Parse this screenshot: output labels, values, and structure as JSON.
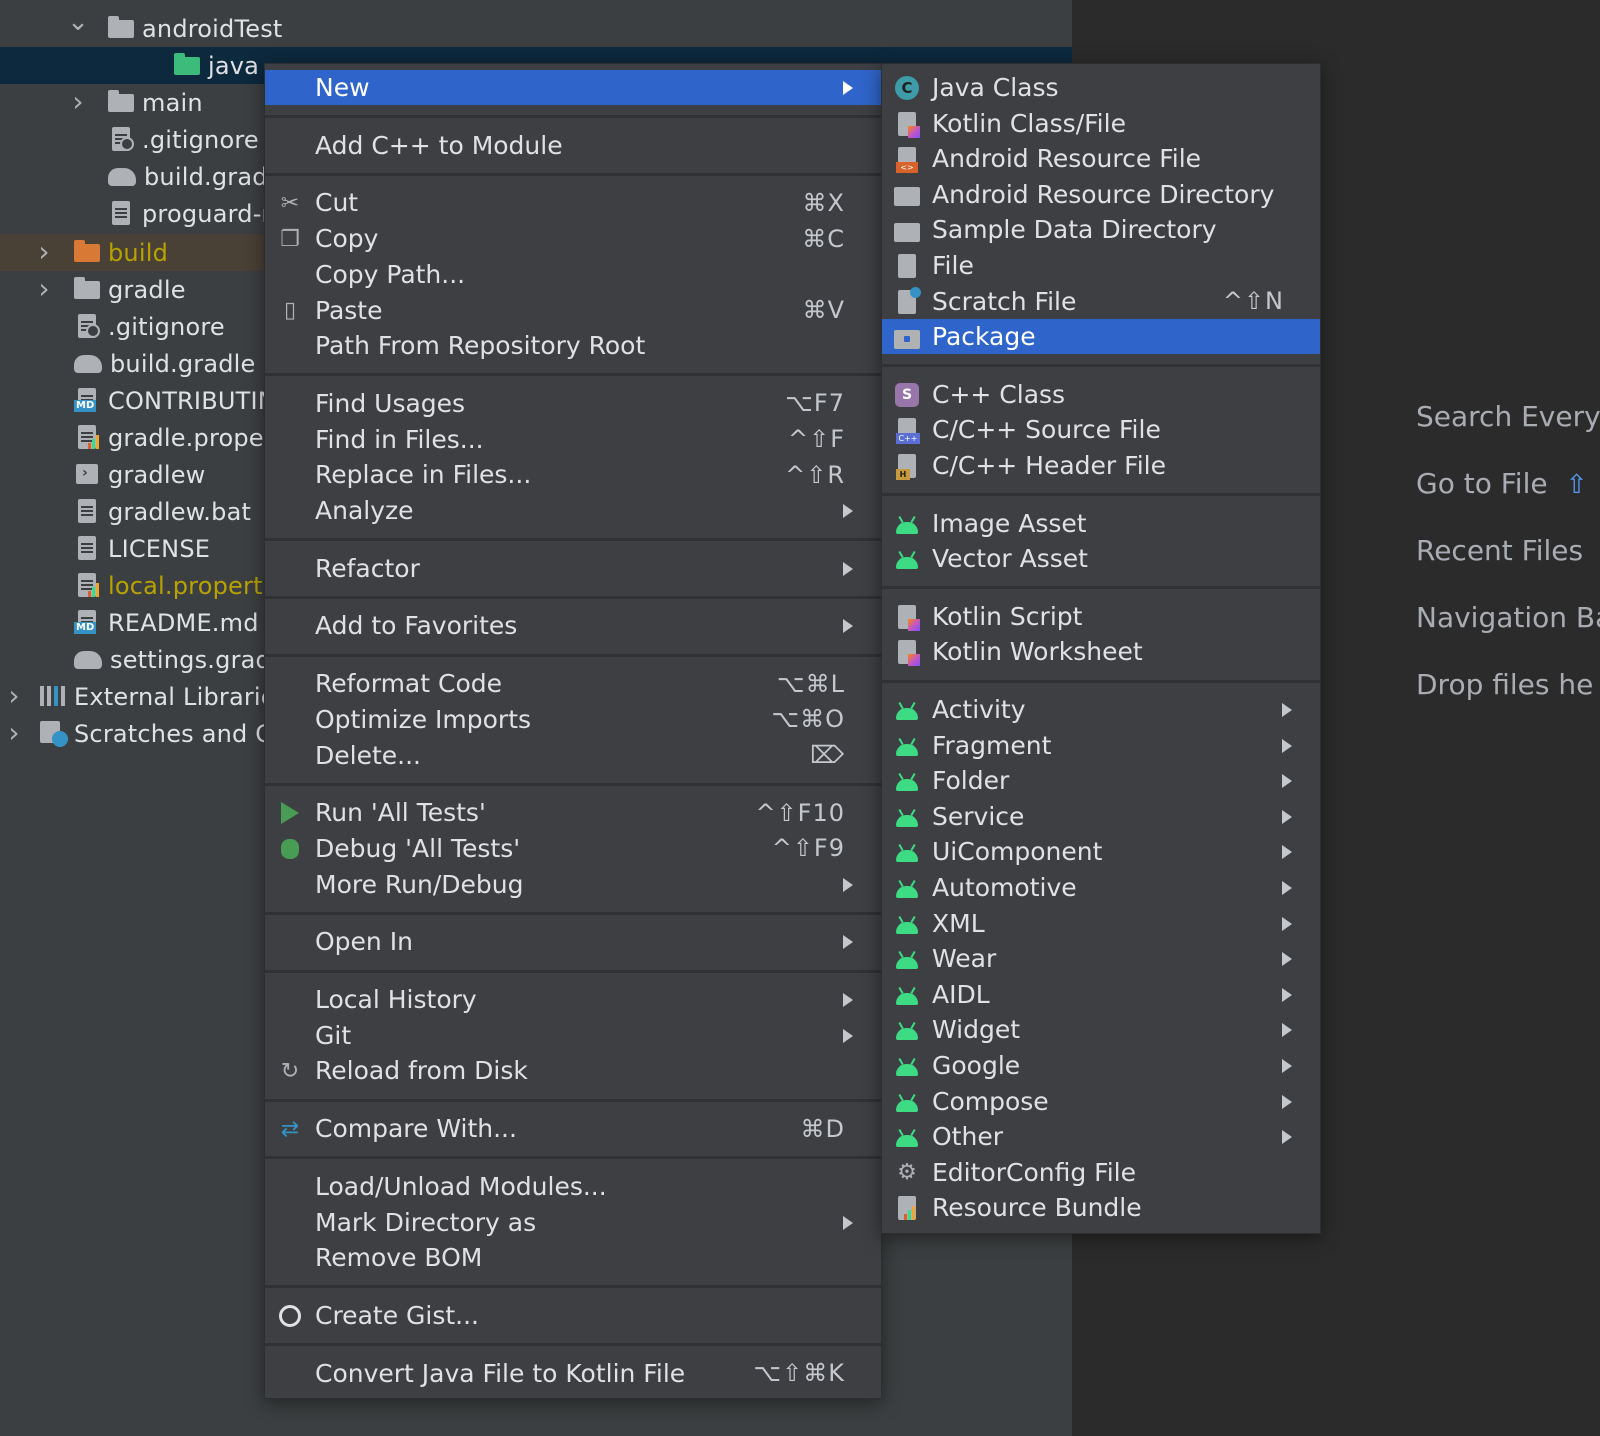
{
  "project_tree": {
    "rows": [
      {
        "label": "androidTest",
        "chevron": "down",
        "icon": "folder-icon"
      },
      {
        "label": "java",
        "icon": "java-source-folder-icon",
        "selected": true,
        "color": "#dfe1e5"
      },
      {
        "label": "main",
        "chevron": "right",
        "icon": "folder-icon"
      },
      {
        "label": ".gitignore",
        "icon": "ignore-file-icon"
      },
      {
        "label": "build.gradl",
        "icon": "gradle-icon"
      },
      {
        "label": "proguard-r",
        "icon": "text-file-icon"
      },
      {
        "label": "build",
        "chevron": "right",
        "icon": "excluded-folder-icon",
        "color": "#b8a200"
      },
      {
        "label": "gradle",
        "chevron": "right",
        "icon": "folder-icon"
      },
      {
        "label": ".gitignore",
        "icon": "ignore-file-icon"
      },
      {
        "label": "build.gradle",
        "icon": "gradle-icon"
      },
      {
        "label": "CONTRIBUTIN",
        "icon": "markdown-file-icon"
      },
      {
        "label": "gradle.proper",
        "icon": "properties-file-icon"
      },
      {
        "label": "gradlew",
        "icon": "shell-script-icon"
      },
      {
        "label": "gradlew.bat",
        "icon": "text-file-icon"
      },
      {
        "label": "LICENSE",
        "icon": "text-file-icon"
      },
      {
        "label": "local.properti",
        "icon": "properties-file-icon",
        "color": "#b8a200"
      },
      {
        "label": "README.md",
        "icon": "markdown-file-icon"
      },
      {
        "label": "settings.gradl",
        "icon": "gradle-icon"
      },
      {
        "label": "External Librarie",
        "chevron": "right",
        "icon": "libraries-icon"
      },
      {
        "label": "Scratches and C",
        "chevron": "right",
        "icon": "scratches-icon"
      }
    ]
  },
  "editor_hints": {
    "search_everywhere": "Search Every",
    "go_to_file": "Go to File",
    "go_to_file_shortcut": "⇧",
    "recent_files": "Recent Files",
    "navigation_bar": "Navigation Ba",
    "drop_files": "Drop files he"
  },
  "context_menu": {
    "items": [
      {
        "label": "New",
        "submenu": true,
        "highlight": true
      },
      {
        "sep": true
      },
      {
        "label": "Add C++ to Module"
      },
      {
        "sep": true
      },
      {
        "label": "Cut",
        "shortcut": "⌘X",
        "icon": "scissors-icon"
      },
      {
        "label": "Copy",
        "shortcut": "⌘C",
        "icon": "copy-icon"
      },
      {
        "label": "Copy Path..."
      },
      {
        "label": "Paste",
        "shortcut": "⌘V",
        "icon": "clipboard-icon"
      },
      {
        "label": "Path From Repository Root"
      },
      {
        "sep": true
      },
      {
        "label": "Find Usages",
        "shortcut": "⌥F7"
      },
      {
        "label": "Find in Files...",
        "shortcut": "^⇧F"
      },
      {
        "label": "Replace in Files...",
        "shortcut": "^⇧R"
      },
      {
        "label": "Analyze",
        "submenu": true
      },
      {
        "sep": true
      },
      {
        "label": "Refactor",
        "submenu": true
      },
      {
        "sep": true
      },
      {
        "label": "Add to Favorites",
        "submenu": true
      },
      {
        "sep": true
      },
      {
        "label": "Reformat Code",
        "shortcut": "⌥⌘L"
      },
      {
        "label": "Optimize Imports",
        "shortcut": "⌥⌘O"
      },
      {
        "label": "Delete...",
        "shortcut": "⌦"
      },
      {
        "sep": true
      },
      {
        "label": "Run 'All Tests'",
        "shortcut": "^⇧F10",
        "icon": "run-icon"
      },
      {
        "label": "Debug 'All Tests'",
        "shortcut": "^⇧F9",
        "icon": "debug-icon"
      },
      {
        "label": "More Run/Debug",
        "submenu": true
      },
      {
        "sep": true
      },
      {
        "label": "Open In",
        "submenu": true
      },
      {
        "sep": true
      },
      {
        "label": "Local History",
        "submenu": true
      },
      {
        "label": "Git",
        "submenu": true
      },
      {
        "label": "Reload from Disk",
        "icon": "reload-icon"
      },
      {
        "sep": true
      },
      {
        "label": "Compare With...",
        "shortcut": "⌘D",
        "icon": "compare-icon"
      },
      {
        "sep": true
      },
      {
        "label": "Load/Unload Modules..."
      },
      {
        "label": "Mark Directory as",
        "submenu": true
      },
      {
        "label": "Remove BOM"
      },
      {
        "sep": true
      },
      {
        "label": "Create Gist...",
        "icon": "github-icon"
      },
      {
        "sep": true
      },
      {
        "label": "Convert Java File to Kotlin File",
        "shortcut": "⌥⇧⌘K"
      }
    ]
  },
  "new_submenu": {
    "items": [
      {
        "label": "Java Class",
        "icon": "java-class-icon"
      },
      {
        "label": "Kotlin Class/File",
        "icon": "kotlin-file-icon"
      },
      {
        "label": "Android Resource File",
        "icon": "android-resource-file-icon"
      },
      {
        "label": "Android Resource Directory",
        "icon": "folder-icon"
      },
      {
        "label": "Sample Data Directory",
        "icon": "folder-icon"
      },
      {
        "label": "File",
        "icon": "file-icon"
      },
      {
        "label": "Scratch File",
        "shortcut": "^⇧N",
        "icon": "scratch-file-icon"
      },
      {
        "label": "Package",
        "icon": "package-icon",
        "highlight": true
      },
      {
        "sep": true
      },
      {
        "label": "C++ Class",
        "icon": "cpp-class-icon"
      },
      {
        "label": "C/C++ Source File",
        "icon": "cpp-source-icon"
      },
      {
        "label": "C/C++ Header File",
        "icon": "cpp-header-icon"
      },
      {
        "sep": true
      },
      {
        "label": "Image Asset",
        "icon": "android-icon"
      },
      {
        "label": "Vector Asset",
        "icon": "android-icon"
      },
      {
        "sep": true
      },
      {
        "label": "Kotlin Script",
        "icon": "kotlin-script-icon"
      },
      {
        "label": "Kotlin Worksheet",
        "icon": "kotlin-worksheet-icon"
      },
      {
        "sep": true
      },
      {
        "label": "Activity",
        "submenu": true,
        "icon": "android-icon"
      },
      {
        "label": "Fragment",
        "submenu": true,
        "icon": "android-icon"
      },
      {
        "label": "Folder",
        "submenu": true,
        "icon": "android-icon"
      },
      {
        "label": "Service",
        "submenu": true,
        "icon": "android-icon"
      },
      {
        "label": "UiComponent",
        "submenu": true,
        "icon": "android-icon"
      },
      {
        "label": "Automotive",
        "submenu": true,
        "icon": "android-icon"
      },
      {
        "label": "XML",
        "submenu": true,
        "icon": "android-icon"
      },
      {
        "label": "Wear",
        "submenu": true,
        "icon": "android-icon"
      },
      {
        "label": "AIDL",
        "submenu": true,
        "icon": "android-icon"
      },
      {
        "label": "Widget",
        "submenu": true,
        "icon": "android-icon"
      },
      {
        "label": "Google",
        "submenu": true,
        "icon": "android-icon"
      },
      {
        "label": "Compose",
        "submenu": true,
        "icon": "android-icon"
      },
      {
        "label": "Other",
        "submenu": true,
        "icon": "android-icon"
      },
      {
        "label": "EditorConfig File",
        "icon": "gear-icon"
      },
      {
        "label": "Resource Bundle",
        "icon": "resource-bundle-icon"
      }
    ]
  },
  "colors": {
    "menu_bg": "#3d3f43",
    "highlight": "#2f65ca",
    "android_green": "#3ddc84",
    "excluded_yellow": "#b8a200"
  }
}
